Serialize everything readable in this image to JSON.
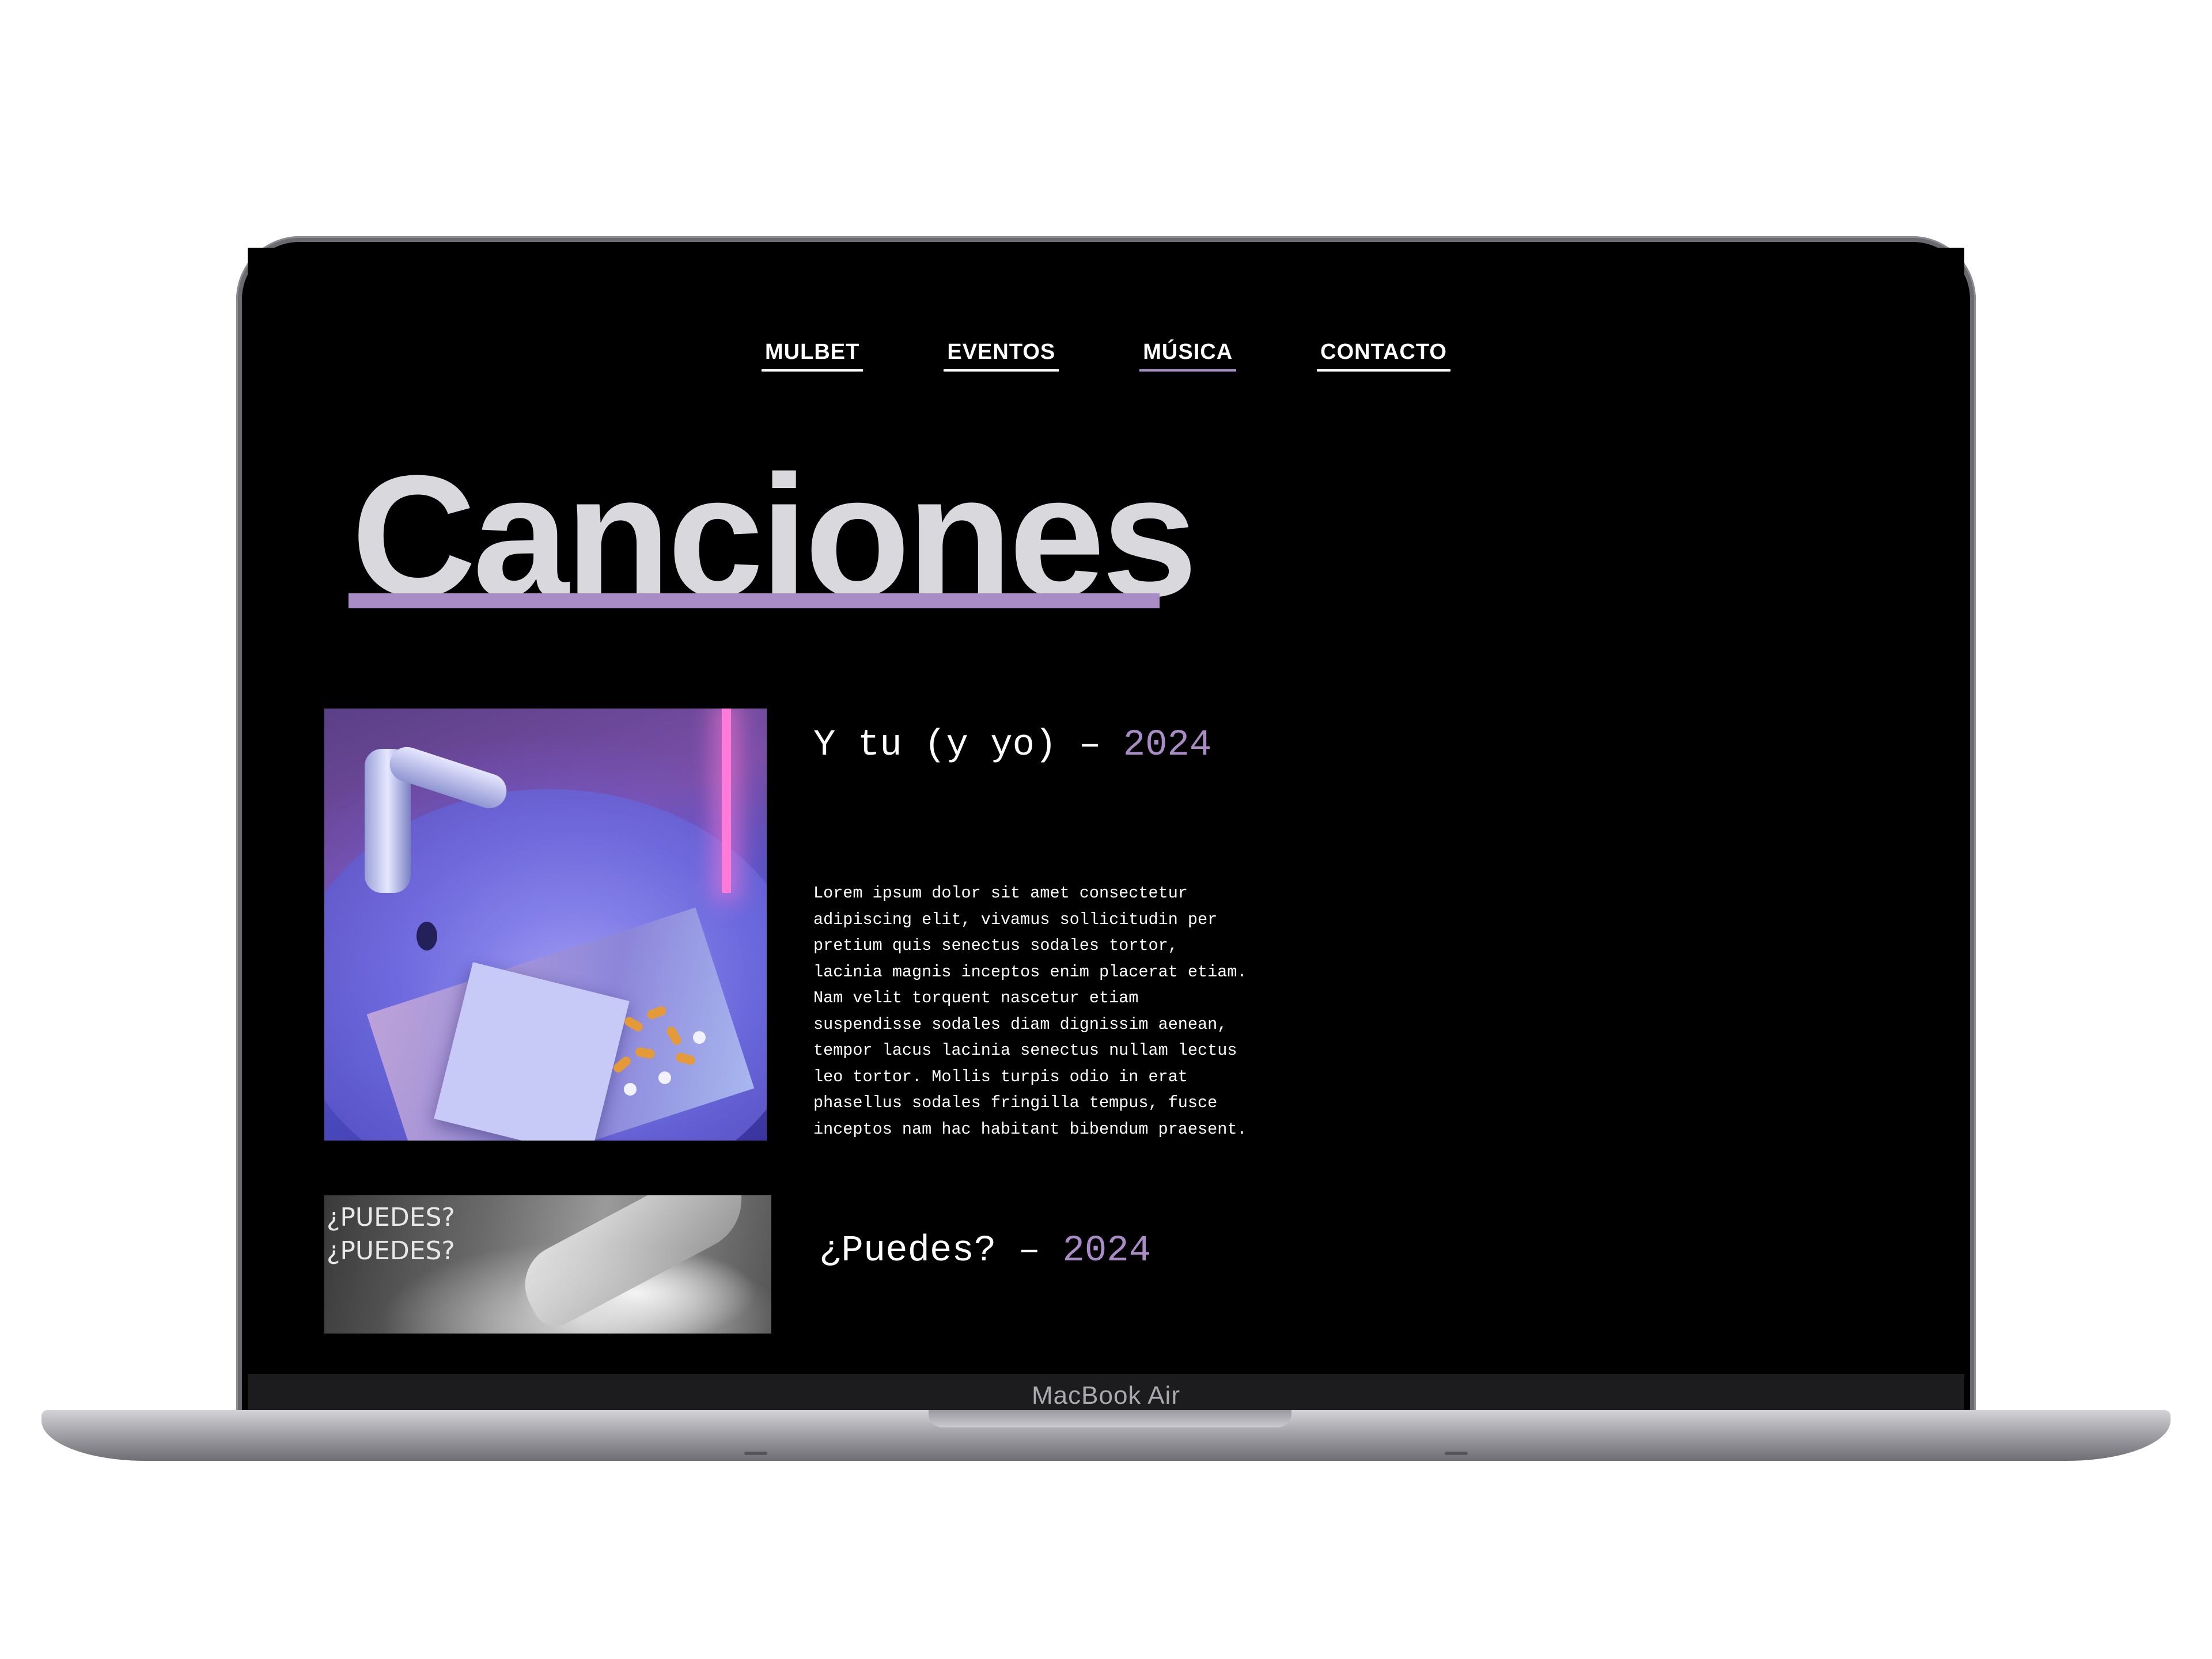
{
  "nav": {
    "items": [
      {
        "label": "MULBET",
        "active": false
      },
      {
        "label": "EVENTOS",
        "active": false
      },
      {
        "label": "MÚSICA",
        "active": true
      },
      {
        "label": "CONTACTO",
        "active": false
      }
    ]
  },
  "page": {
    "title": "Canciones"
  },
  "songs": [
    {
      "title": "Y tu (y yo)",
      "separator": " – ",
      "year": "2024",
      "description": "Lorem ipsum dolor sit amet consectetur\nadipiscing elit, vivamus sollicitudin per\npretium quis senectus sodales tortor,\nlacinia magnis inceptos enim placerat etiam.\nNam velit torquent nascetur etiam\nsuspendisse sodales diam dignissim aenean,\ntempor lacus lacinia senectus nullam lectus\nleo tortor. Mollis turpis odio in erat\nphasellus sodales fringilla tempus, fusce\ninceptos nam hac habitant bibendum praesent."
    },
    {
      "title": "¿Puedes?",
      "separator": " – ",
      "year": "2024",
      "cover_text": "¿PUEDES?\n¿PUEDES?"
    }
  ],
  "device": {
    "label": "MacBook Air"
  },
  "colors": {
    "accent": "#a98bc6",
    "background": "#000000",
    "text": "#ffffff",
    "title": "#d9d9dd"
  }
}
